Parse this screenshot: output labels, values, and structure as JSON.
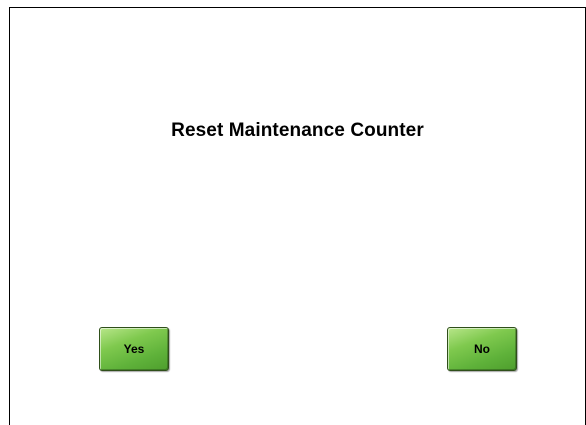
{
  "dialog": {
    "title": "Reset Maintenance Counter",
    "buttons": {
      "yes_label": "Yes",
      "no_label": "No"
    },
    "colors": {
      "button_green": "#5fb23a",
      "border": "#000000",
      "background": "#ffffff"
    }
  }
}
